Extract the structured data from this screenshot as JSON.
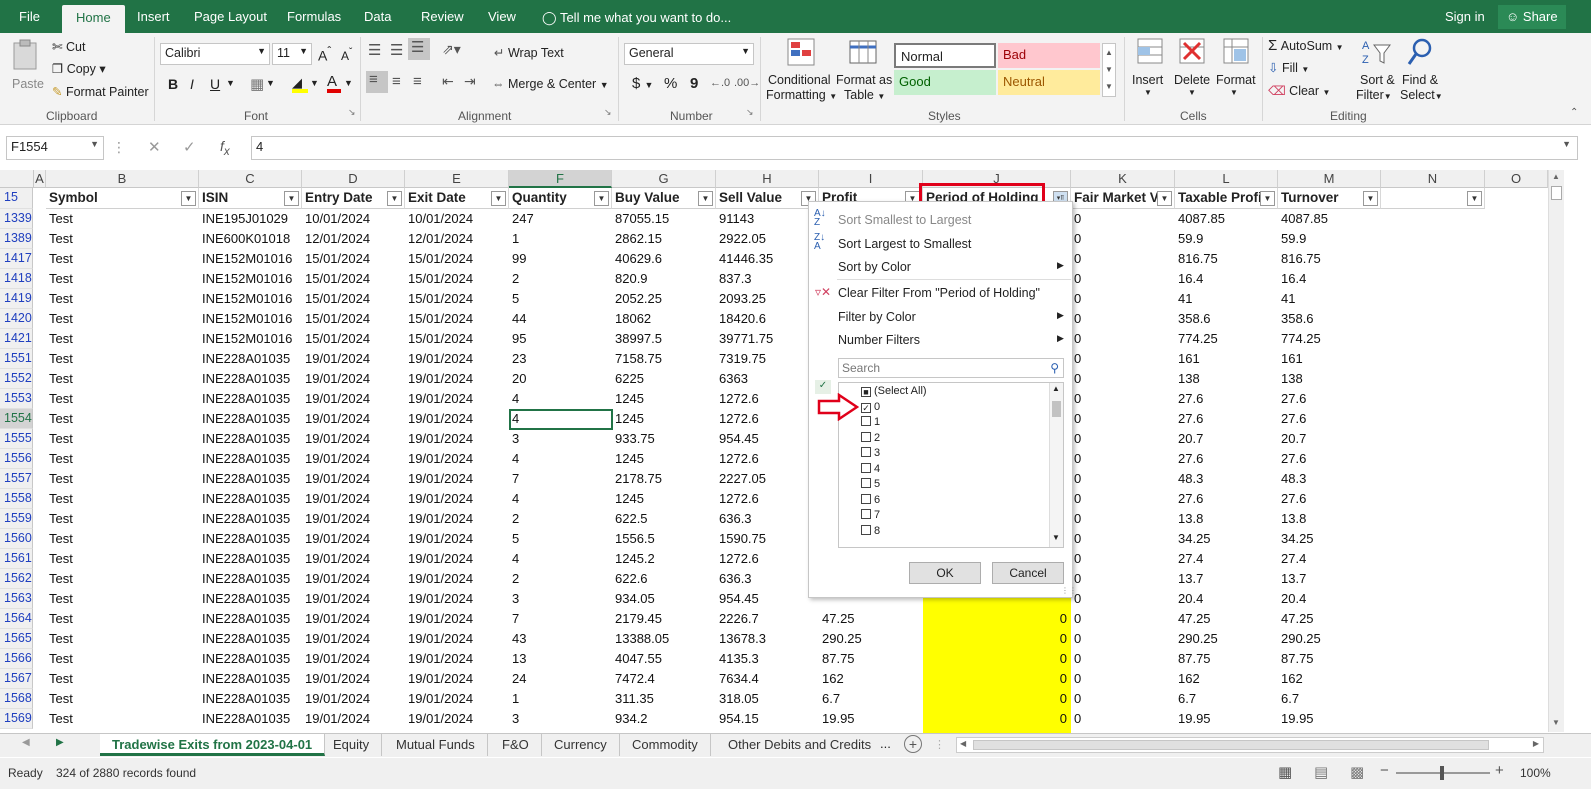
{
  "ribbon_tabs": [
    "File",
    "Home",
    "Insert",
    "Page Layout",
    "Formulas",
    "Data",
    "Review",
    "View"
  ],
  "tell_me": "Tell me what you want to do...",
  "sign_in": "Sign in",
  "share": "Share",
  "clipboard": {
    "paste": "Paste",
    "cut": "Cut",
    "copy": "Copy",
    "format_painter": "Format Painter",
    "label": "Clipboard"
  },
  "font": {
    "name": "Calibri",
    "size": "11",
    "label": "Font"
  },
  "alignment": {
    "wrap": "Wrap Text",
    "merge": "Merge & Center",
    "label": "Alignment"
  },
  "number": {
    "format": "General",
    "label": "Number",
    "currency": "$",
    "percent": "%",
    "comma": "9"
  },
  "styles": {
    "conditional": [
      "Conditional",
      "Formatting"
    ],
    "format_as": [
      "Format as",
      "Table"
    ],
    "normal": "Normal",
    "bad": "Bad",
    "good": "Good",
    "neutral": "Neutral",
    "label": "Styles"
  },
  "cells": {
    "insert": "Insert",
    "delete": "Delete",
    "format": "Format",
    "label": "Cells"
  },
  "editing": {
    "autosum": "AutoSum",
    "fill": "Fill",
    "clear": "Clear",
    "sort": [
      "Sort &",
      "Filter"
    ],
    "find": [
      "Find &",
      "Select"
    ],
    "label": "Editing"
  },
  "name_box": "F1554",
  "formula_value": "4",
  "columns": [
    "A",
    "B",
    "C",
    "D",
    "E",
    "F",
    "G",
    "H",
    "I",
    "J",
    "K",
    "L",
    "M",
    "N",
    "O"
  ],
  "header_row_num": "15",
  "headers": [
    "Symbol",
    "ISIN",
    "Entry Date",
    "Exit Date",
    "Quantity",
    "Buy Value",
    "Sell Value",
    "Profit",
    "Period of Holding",
    "Fair Market Va",
    "Taxable Profit",
    "Turnover"
  ],
  "rows": [
    [
      "1339",
      "Test",
      "INE195J01029",
      "10/01/2024",
      "10/01/2024",
      "247",
      "87055.15",
      "91143",
      "",
      "",
      "0",
      "4087.85",
      "4087.85"
    ],
    [
      "1389",
      "Test",
      "INE600K01018",
      "12/01/2024",
      "12/01/2024",
      "1",
      "2862.15",
      "2922.05",
      "",
      "",
      "0",
      "59.9",
      "59.9"
    ],
    [
      "1417",
      "Test",
      "INE152M01016",
      "15/01/2024",
      "15/01/2024",
      "99",
      "40629.6",
      "41446.35",
      "",
      "",
      "0",
      "816.75",
      "816.75"
    ],
    [
      "1418",
      "Test",
      "INE152M01016",
      "15/01/2024",
      "15/01/2024",
      "2",
      "820.9",
      "837.3",
      "",
      "",
      "0",
      "16.4",
      "16.4"
    ],
    [
      "1419",
      "Test",
      "INE152M01016",
      "15/01/2024",
      "15/01/2024",
      "5",
      "2052.25",
      "2093.25",
      "",
      "",
      "0",
      "41",
      "41"
    ],
    [
      "1420",
      "Test",
      "INE152M01016",
      "15/01/2024",
      "15/01/2024",
      "44",
      "18062",
      "18420.6",
      "",
      "",
      "0",
      "358.6",
      "358.6"
    ],
    [
      "1421",
      "Test",
      "INE152M01016",
      "15/01/2024",
      "15/01/2024",
      "95",
      "38997.5",
      "39771.75",
      "",
      "",
      "0",
      "774.25",
      "774.25"
    ],
    [
      "1551",
      "Test",
      "INE228A01035",
      "19/01/2024",
      "19/01/2024",
      "23",
      "7158.75",
      "7319.75",
      "",
      "",
      "0",
      "161",
      "161"
    ],
    [
      "1552",
      "Test",
      "INE228A01035",
      "19/01/2024",
      "19/01/2024",
      "20",
      "6225",
      "6363",
      "",
      "",
      "0",
      "138",
      "138"
    ],
    [
      "1553",
      "Test",
      "INE228A01035",
      "19/01/2024",
      "19/01/2024",
      "4",
      "1245",
      "1272.6",
      "",
      "",
      "0",
      "27.6",
      "27.6"
    ],
    [
      "1554",
      "Test",
      "INE228A01035",
      "19/01/2024",
      "19/01/2024",
      "4",
      "1245",
      "1272.6",
      "",
      "",
      "0",
      "27.6",
      "27.6"
    ],
    [
      "1555",
      "Test",
      "INE228A01035",
      "19/01/2024",
      "19/01/2024",
      "3",
      "933.75",
      "954.45",
      "",
      "",
      "0",
      "20.7",
      "20.7"
    ],
    [
      "1556",
      "Test",
      "INE228A01035",
      "19/01/2024",
      "19/01/2024",
      "4",
      "1245",
      "1272.6",
      "",
      "",
      "0",
      "27.6",
      "27.6"
    ],
    [
      "1557",
      "Test",
      "INE228A01035",
      "19/01/2024",
      "19/01/2024",
      "7",
      "2178.75",
      "2227.05",
      "",
      "",
      "0",
      "48.3",
      "48.3"
    ],
    [
      "1558",
      "Test",
      "INE228A01035",
      "19/01/2024",
      "19/01/2024",
      "4",
      "1245",
      "1272.6",
      "",
      "",
      "0",
      "27.6",
      "27.6"
    ],
    [
      "1559",
      "Test",
      "INE228A01035",
      "19/01/2024",
      "19/01/2024",
      "2",
      "622.5",
      "636.3",
      "",
      "",
      "0",
      "13.8",
      "13.8"
    ],
    [
      "1560",
      "Test",
      "INE228A01035",
      "19/01/2024",
      "19/01/2024",
      "5",
      "1556.5",
      "1590.75",
      "",
      "",
      "0",
      "34.25",
      "34.25"
    ],
    [
      "1561",
      "Test",
      "INE228A01035",
      "19/01/2024",
      "19/01/2024",
      "4",
      "1245.2",
      "1272.6",
      "",
      "",
      "0",
      "27.4",
      "27.4"
    ],
    [
      "1562",
      "Test",
      "INE228A01035",
      "19/01/2024",
      "19/01/2024",
      "2",
      "622.6",
      "636.3",
      "",
      "",
      "0",
      "13.7",
      "13.7"
    ],
    [
      "1563",
      "Test",
      "INE228A01035",
      "19/01/2024",
      "19/01/2024",
      "3",
      "934.05",
      "954.45",
      "",
      "",
      "0",
      "20.4",
      "20.4"
    ],
    [
      "1564",
      "Test",
      "INE228A01035",
      "19/01/2024",
      "19/01/2024",
      "7",
      "2179.45",
      "2226.7",
      "47.25",
      "0",
      "0",
      "47.25",
      "47.25"
    ],
    [
      "1565",
      "Test",
      "INE228A01035",
      "19/01/2024",
      "19/01/2024",
      "43",
      "13388.05",
      "13678.3",
      "290.25",
      "0",
      "0",
      "290.25",
      "290.25"
    ],
    [
      "1566",
      "Test",
      "INE228A01035",
      "19/01/2024",
      "19/01/2024",
      "13",
      "4047.55",
      "4135.3",
      "87.75",
      "0",
      "0",
      "87.75",
      "87.75"
    ],
    [
      "1567",
      "Test",
      "INE228A01035",
      "19/01/2024",
      "19/01/2024",
      "24",
      "7472.4",
      "7634.4",
      "162",
      "0",
      "0",
      "162",
      "162"
    ],
    [
      "1568",
      "Test",
      "INE228A01035",
      "19/01/2024",
      "19/01/2024",
      "1",
      "311.35",
      "318.05",
      "6.7",
      "0",
      "0",
      "6.7",
      "6.7"
    ],
    [
      "1569",
      "Test",
      "INE228A01035",
      "19/01/2024",
      "19/01/2024",
      "3",
      "934.2",
      "954.15",
      "19.95",
      "0",
      "0",
      "19.95",
      "19.95"
    ]
  ],
  "filter_menu": {
    "sort_asc": "Sort Smallest to Largest",
    "sort_desc": "Sort Largest to Smallest",
    "sort_color": "Sort by Color",
    "clear_filter": "Clear Filter From \"Period of Holding\"",
    "filter_color": "Filter by Color",
    "number_filters": "Number Filters",
    "search_placeholder": "Search",
    "items": [
      "(Select All)",
      "0",
      "1",
      "2",
      "3",
      "4",
      "5",
      "6",
      "7",
      "8"
    ],
    "ok": "OK",
    "cancel": "Cancel"
  },
  "sheet_tabs": [
    "Tradewise Exits from 2023-04-01",
    "Equity",
    "Mutual Funds",
    "F&O",
    "Currency",
    "Commodity",
    "Other Debits and Credits"
  ],
  "sheet_more": "...",
  "status_ready": "Ready",
  "status_records": "324 of 2880 records found",
  "zoom": "100%",
  "colors": {
    "excel_green": "#217346",
    "highlight_yellow": "#ffff00",
    "callout_red": "#e0001a"
  }
}
